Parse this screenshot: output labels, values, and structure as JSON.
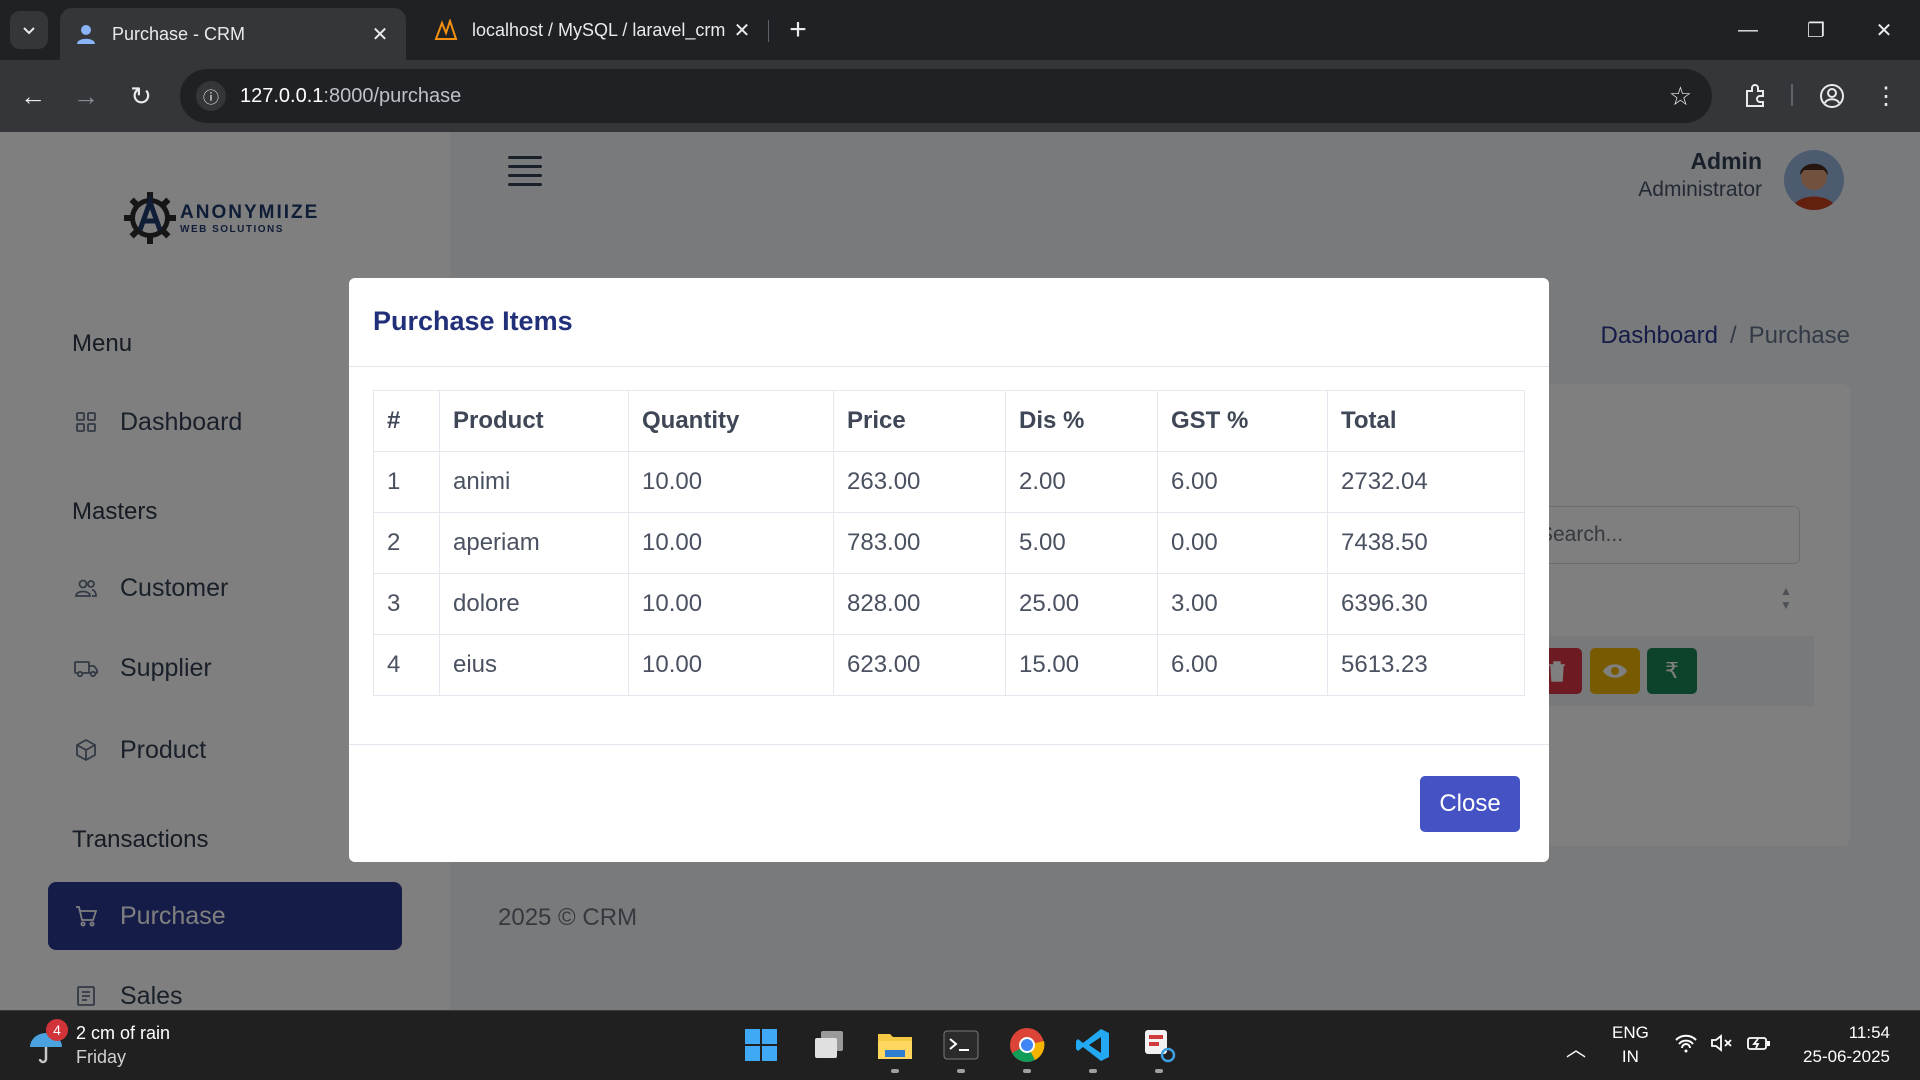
{
  "browser": {
    "tabs": [
      {
        "title": "Purchase - CRM",
        "active": true
      },
      {
        "title": "localhost / MySQL / laravel_crm",
        "active": false
      }
    ],
    "url_host": "127.0.0.1",
    "url_path": ":8000/purchase"
  },
  "app": {
    "logo": {
      "name": "ANONYMIIZE",
      "sub": "WEB SOLUTIONS"
    },
    "user": {
      "name": "Admin",
      "role": "Administrator"
    },
    "sidebar": {
      "sections": [
        {
          "title": "Menu",
          "items": [
            {
              "label": "Dashboard",
              "icon": "grid-icon"
            }
          ]
        },
        {
          "title": "Masters",
          "items": [
            {
              "label": "Customer",
              "icon": "users-icon"
            },
            {
              "label": "Supplier",
              "icon": "truck-icon"
            },
            {
              "label": "Product",
              "icon": "box-icon"
            }
          ]
        },
        {
          "title": "Transactions",
          "items": [
            {
              "label": "Purchase",
              "icon": "cart-icon",
              "active": true
            },
            {
              "label": "Sales",
              "icon": "invoice-icon"
            }
          ]
        }
      ]
    },
    "breadcrumb": {
      "home": "Dashboard",
      "separator": "/",
      "current": "Purchase"
    },
    "search_placeholder": "Search...",
    "footer": "2025 © CRM"
  },
  "modal": {
    "title": "Purchase Items",
    "columns": [
      "#",
      "Product",
      "Quantity",
      "Price",
      "Dis %",
      "GST %",
      "Total"
    ],
    "rows": [
      [
        "1",
        "animi",
        "10.00",
        "263.00",
        "2.00",
        "6.00",
        "2732.04"
      ],
      [
        "2",
        "aperiam",
        "10.00",
        "783.00",
        "5.00",
        "0.00",
        "7438.50"
      ],
      [
        "3",
        "dolore",
        "10.00",
        "828.00",
        "25.00",
        "3.00",
        "6396.30"
      ],
      [
        "4",
        "eius",
        "10.00",
        "623.00",
        "15.00",
        "6.00",
        "5613.23"
      ]
    ],
    "close_label": "Close"
  },
  "taskbar": {
    "weather": {
      "badge": "4",
      "line1": "2 cm of rain",
      "line2": "Friday"
    },
    "lang": {
      "line1": "ENG",
      "line2": "IN"
    },
    "clock": {
      "time": "11:54",
      "date": "25-06-2025"
    }
  },
  "colors": {
    "primary": "#2b3990",
    "danger": "#dc3545",
    "warning": "#f0b400",
    "success": "#198754"
  }
}
